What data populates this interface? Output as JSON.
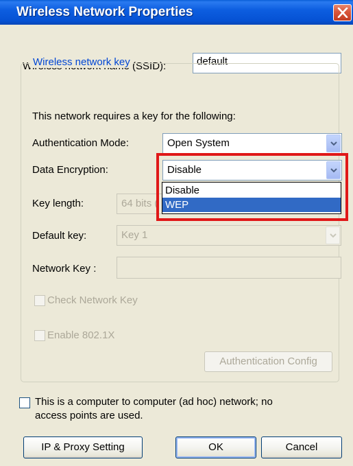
{
  "window": {
    "title": "Wireless Network Properties"
  },
  "ssid": {
    "label": "Wireless network name (SSID):",
    "value": "default"
  },
  "key_group": {
    "legend": "Wireless network key",
    "description": "This network requires a key for the following:",
    "auth_mode": {
      "label": "Authentication Mode:",
      "value": "Open System"
    },
    "data_encryption": {
      "label": "Data Encryption:",
      "value": "Disable",
      "options": [
        "Disable",
        "WEP"
      ],
      "highlighted": "WEP"
    },
    "key_length": {
      "label": "Key length:",
      "value": "64 bits ("
    },
    "default_key": {
      "label": "Default key:",
      "value": "Key 1"
    },
    "network_key": {
      "label": "Network Key :",
      "value": ""
    },
    "check_network_key": {
      "label": "Check Network Key",
      "checked": false
    },
    "enable_8021x": {
      "label": "Enable 802.1X",
      "checked": false
    },
    "auth_config_button": "Authentication Config"
  },
  "adhoc": {
    "label_line1": "This is a computer to computer (ad hoc) network; no",
    "label_line2": "access points are used.",
    "checked": false
  },
  "buttons": {
    "ip_proxy": "IP & Proxy Setting",
    "ok": "OK",
    "cancel": "Cancel"
  },
  "colors": {
    "title_bar": "#0551d3",
    "highlight_border": "#e01818",
    "selection": "#316ac5",
    "group_legend": "#0046d5"
  }
}
